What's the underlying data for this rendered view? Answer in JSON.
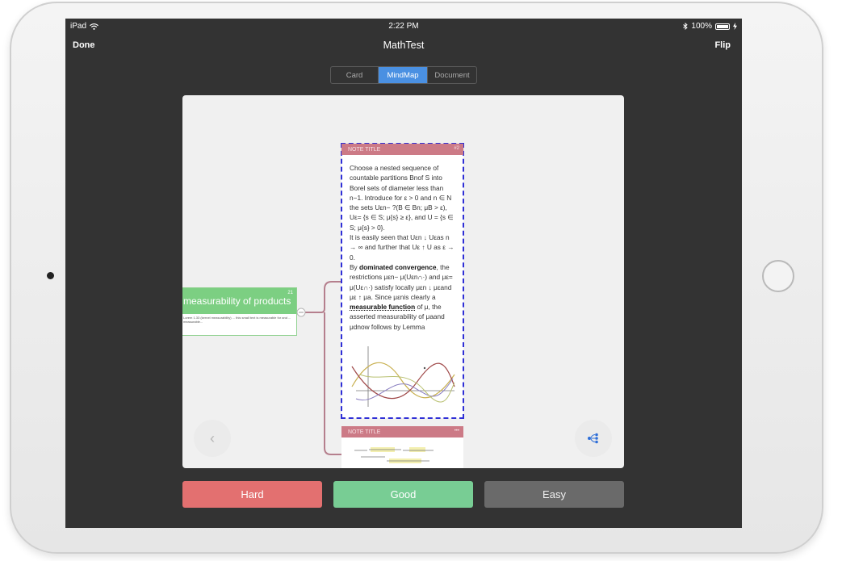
{
  "status_bar": {
    "device": "iPad",
    "time": "2:22 PM",
    "battery": "100%"
  },
  "nav": {
    "left_button": "Done",
    "title": "MathTest",
    "right_button": "Flip"
  },
  "view_modes": {
    "options": [
      "Card",
      "MindMap",
      "Document"
    ],
    "selected": "MindMap"
  },
  "mindmap": {
    "root_node": {
      "title": "measurability of products",
      "badge": "21",
      "body": "Lorem 1.33 (kernel measurability) ... this small text is measurable for and ... measurable..."
    },
    "note_card": {
      "header": "NOTE TITLE",
      "badge": "#2",
      "text_1": "Choose a nested sequence of countable partitions Bnof S into Borel sets of diameter less than n−1. Introduce for ε > 0 and n ∈ N the sets Uεn− ?(B ∈ Bn; μB > ε), Uε= {s ∈ S; μ{s} ≥ ε}, and U = {s ∈ S; μ{s} > 0}.",
      "text_2": "It is easily seen that Uεn ↓ Uεas n → ∞ and further that Uε ↑ U as ε → 0.",
      "text_3_pre": "By ",
      "text_3_bold": "dominated convergence",
      "text_3_post": ", the restrictions μεn− μ(Uεn∩·) and με= μ(Uε∩·) satisfy locally μεn ↓ μεand με ↑ μa. Since μεnis clearly a ",
      "text_3_link": "measurable function",
      "text_3_end": " of μ, the asserted measurability of μaand μdnow follows by Lemma"
    },
    "note_card_2": {
      "header": "NOTE TITLE",
      "badge": "•••"
    }
  },
  "navigation": {
    "prev_glyph": "‹"
  },
  "rating_buttons": {
    "hard": "Hard",
    "good": "Good",
    "easy": "Easy"
  },
  "colors": {
    "hard": "#e37070",
    "good": "#78cd94",
    "easy": "#6a6a6a",
    "accent": "#4a90e2",
    "note_header": "#cc7a86",
    "root_header": "#7ccf82"
  }
}
